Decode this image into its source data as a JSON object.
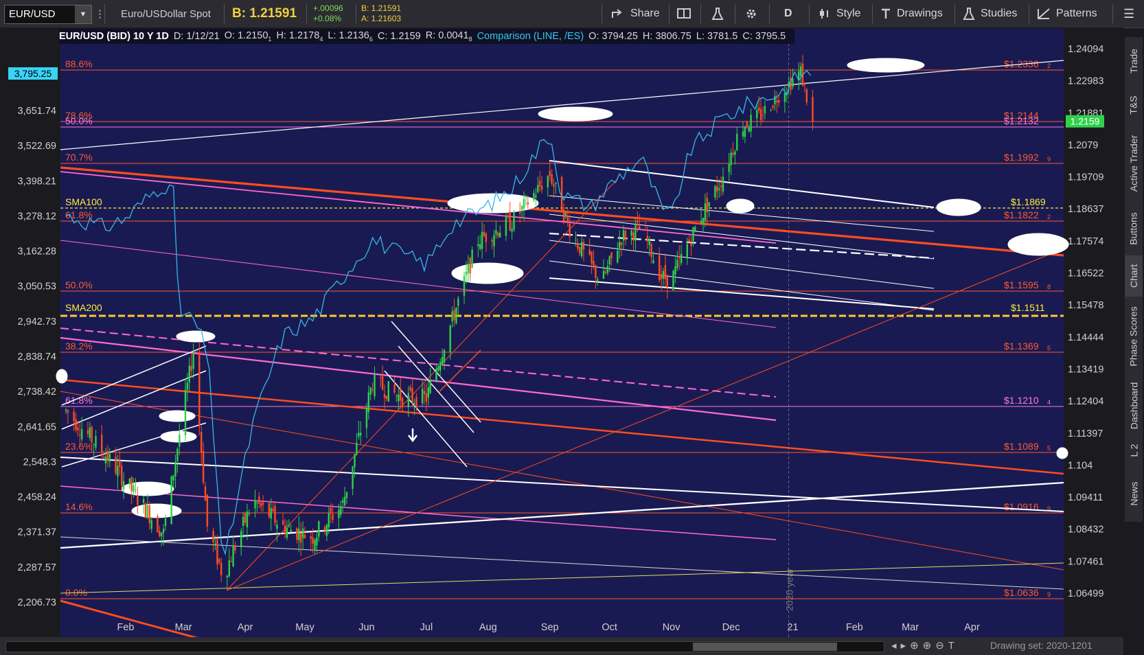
{
  "toolbar": {
    "symbol": "EUR/USD",
    "description": "Euro/USDollar Spot",
    "bid_label": "B: 1.21591",
    "change_abs": "+.00096",
    "change_pct": "+0.08%",
    "bid_small": "B: 1.21591",
    "ask_small": "A: 1.21603",
    "share": "Share",
    "period": "D",
    "style": "Style",
    "drawings": "Drawings",
    "studies": "Studies",
    "patterns": "Patterns"
  },
  "header": {
    "title": "EUR/USD (BID) 10 Y 1D",
    "date": "D: 1/12/21",
    "open": "O: 1.2150",
    "open_sub": "1",
    "high": "H: 1.2178",
    "high_sub": "4",
    "low": "L: 1.2136",
    "low_sub": "6",
    "close": "C: 1.2159",
    "range": "R: 0.0041",
    "range_sub": "8",
    "comparison": "Comparison (LINE, /ES)",
    "c_open": "O: 3794.25",
    "c_high": "H: 3806.75",
    "c_low": "L: 3781.5",
    "c_close": "C: 3795.5"
  },
  "chart_data": {
    "type": "candlestick",
    "series": [
      {
        "name": "EUR/USD",
        "axis": "right"
      },
      {
        "name": "Comparison (LINE, /ES)",
        "axis": "left"
      }
    ],
    "left_axis": {
      "ticks": [
        "3,651.74",
        "3,522.69",
        "3,398.21",
        "3,278.12",
        "3,162.28",
        "3,050.53",
        "2,942.73",
        "2,838.74",
        "2,738.42",
        "2,641.65",
        "2,548.3",
        "2,458.24",
        "2,371.37",
        "2,287.57",
        "2,206.73"
      ],
      "current": "3,795.25"
    },
    "right_axis": {
      "ticks": [
        "1.24094",
        "1.22983",
        "1.21881",
        "1.2079",
        "1.19709",
        "1.18637",
        "1.17574",
        "1.16522",
        "1.15478",
        "1.14444",
        "1.13419",
        "1.12404",
        "1.11397",
        "1.104",
        "1.09411",
        "1.08432",
        "1.07461",
        "1.06499"
      ],
      "current": "1.2159"
    },
    "x_axis": {
      "ticks": [
        "Feb",
        "Mar",
        "Apr",
        "May",
        "Jun",
        "Jul",
        "Aug",
        "Sep",
        "Oct",
        "Nov",
        "Dec",
        "21",
        "Feb",
        "Mar",
        "Apr"
      ],
      "divider_label": "2020 year"
    },
    "fib_levels": [
      {
        "pct": "88.6%",
        "price": "$1.2336",
        "sub": "2"
      },
      {
        "pct": "78.6%",
        "price": "$1.2144",
        "sub": ""
      },
      {
        "pct": "50.0%",
        "price": "$1.2132",
        "sub": ""
      },
      {
        "pct": "70.7%",
        "price": "$1.1992",
        "sub": "9"
      },
      {
        "pct": "61.8%",
        "price": "$1.1822",
        "sub": "2"
      },
      {
        "pct": "50.0%",
        "price": "$1.1595",
        "sub": "8"
      },
      {
        "pct": "38.2%",
        "price": "$1.1369",
        "sub": "5"
      },
      {
        "pct": "61.8%",
        "price": "$1.1210",
        "sub": "4"
      },
      {
        "pct": "23.6%",
        "price": "$1.1089",
        "sub": "5"
      },
      {
        "pct": "14.6%",
        "price": "$1.0916",
        "sub": "9"
      },
      {
        "pct": "0.0%",
        "price": "$1.0636",
        "sub": "9"
      }
    ],
    "sma100": {
      "label": "SMA100",
      "price": "$1.1869"
    },
    "sma200": {
      "label": "SMA200",
      "price": "$1.1511"
    }
  },
  "right_tabs": [
    "Trade",
    "T&S",
    "Active Trader",
    "Buttons",
    "Chart",
    "Phase Scores",
    "Dashboard",
    "L 2",
    "News"
  ],
  "bottom": {
    "drawing_set": "Drawing set: 2020-1201"
  },
  "colors": {
    "plot_bg": "#1a1a52",
    "up": "#2fd14a",
    "down": "#ff4d1f",
    "comparison": "#35b8e6",
    "fib": "#ff5a2e",
    "sma": "#ffee33",
    "purple": "#d86be0"
  }
}
